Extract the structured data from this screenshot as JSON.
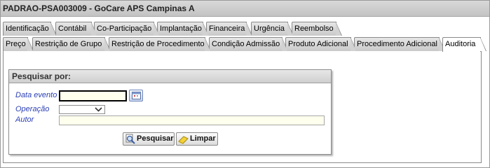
{
  "window": {
    "title": "PADRAO-PSA003009 - GoCare APS Campinas A"
  },
  "tabs_row1": [
    {
      "label": "Identificação"
    },
    {
      "label": "Contábil"
    },
    {
      "label": "Co-Participação"
    },
    {
      "label": "Implantação"
    },
    {
      "label": "Financeira"
    },
    {
      "label": "Urgência"
    },
    {
      "label": "Reembolso"
    }
  ],
  "tabs_row2": [
    {
      "label": "Preço"
    },
    {
      "label": "Restrição de Grupo"
    },
    {
      "label": "Restrição de Procedimento"
    },
    {
      "label": "Condição Admissão"
    },
    {
      "label": "Produto Adicional"
    },
    {
      "label": "Procedimento Adicional"
    },
    {
      "label": "Auditoria",
      "active": true
    }
  ],
  "search_panel": {
    "title": "Pesquisar por:",
    "fields": {
      "data_evento": {
        "label": "Data evento",
        "value": ""
      },
      "operacao": {
        "label": "Operação",
        "value": ""
      },
      "autor": {
        "label": "Autor",
        "value": ""
      }
    },
    "buttons": {
      "search": "Pesquisar",
      "clear": "Limpar"
    }
  },
  "colors": {
    "label_blue": "#2b3fb5",
    "input_bg": "#ffffee",
    "tab_gray": "#d2d2d2"
  },
  "icons": {
    "calendar": "calendar-icon",
    "search": "magnifier-icon",
    "clear": "eraser-icon",
    "dropdown": "chevron-down-icon"
  }
}
